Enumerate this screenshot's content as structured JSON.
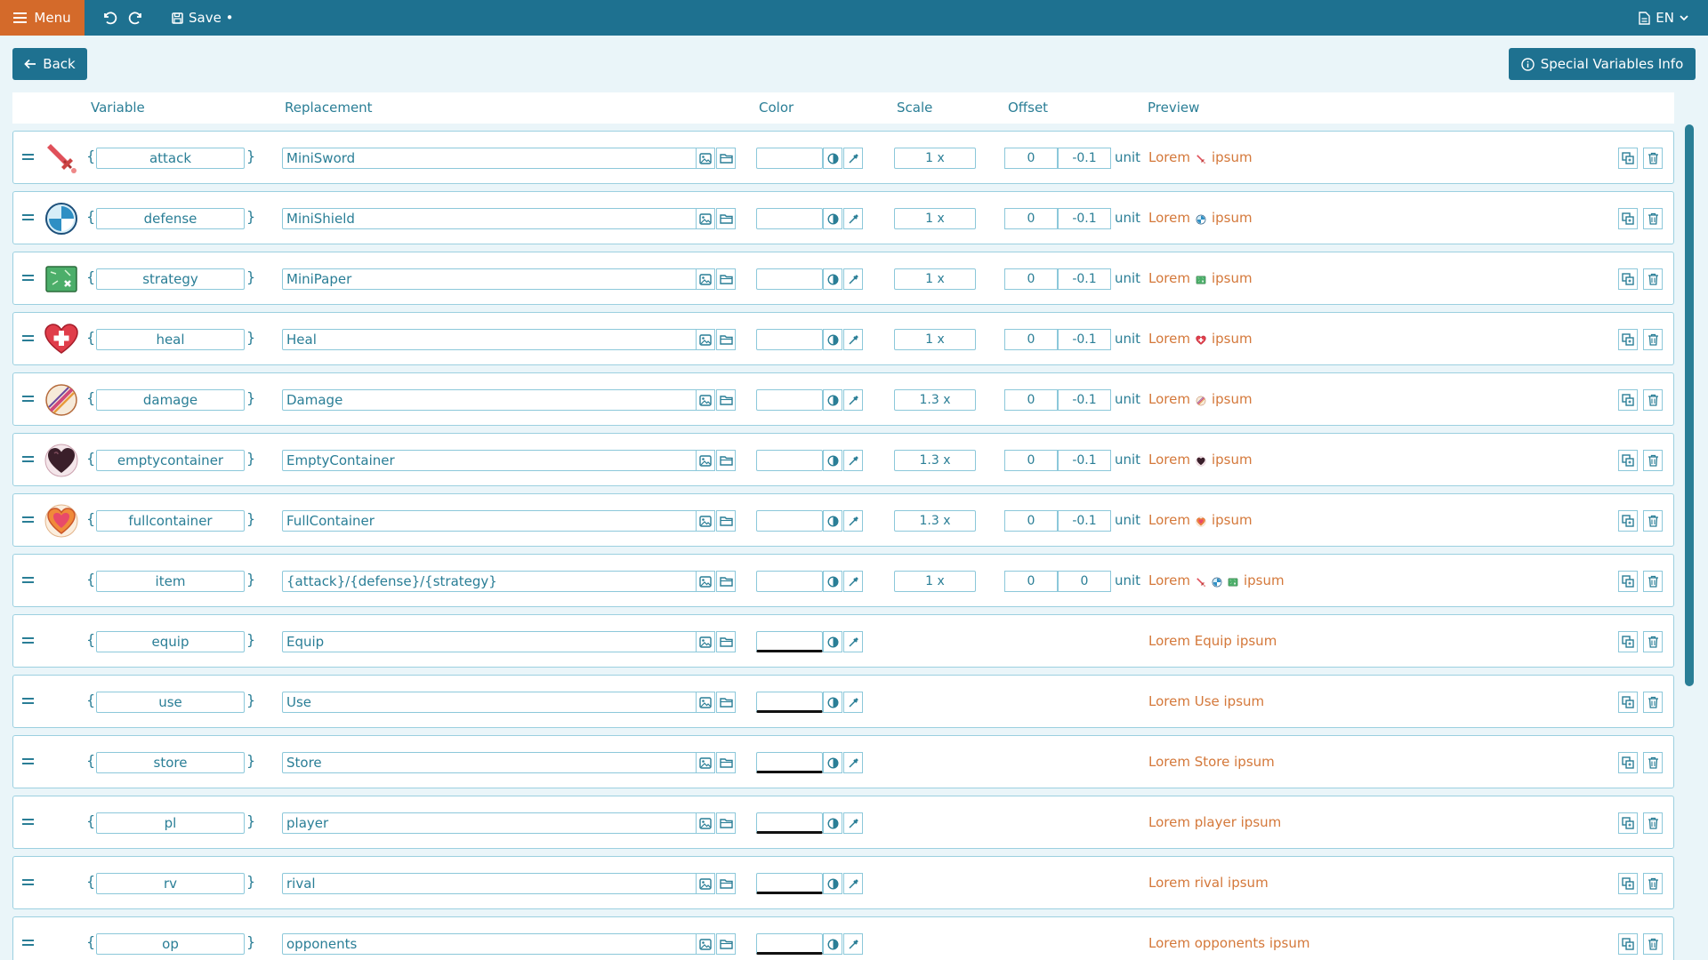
{
  "topbar": {
    "menu_label": "Menu",
    "save_label": "Save •",
    "lang_label": "EN"
  },
  "actions": {
    "back_label": "Back",
    "info_label": "Special Variables Info"
  },
  "columns": {
    "variable": "Variable",
    "replacement": "Replacement",
    "color": "Color",
    "scale": "Scale",
    "offset": "Offset",
    "preview": "Preview"
  },
  "unit_label": "unit",
  "rows": [
    {
      "variable": "attack",
      "replacement": "MiniSword",
      "scale": "1 x",
      "offset_x": "0",
      "offset_y": "-0.1",
      "icon": "sword-icon",
      "icon_color": "#e0505a",
      "preview_before": "Lorem",
      "preview_after": "ipsum",
      "preview_icons": [
        "sword-icon"
      ]
    },
    {
      "variable": "defense",
      "replacement": "MiniShield",
      "scale": "1 x",
      "offset_x": "0",
      "offset_y": "-0.1",
      "icon": "shield-icon",
      "icon_color": "#2f8fc4",
      "preview_before": "Lorem",
      "preview_after": "ipsum",
      "preview_icons": [
        "shield-icon"
      ]
    },
    {
      "variable": "strategy",
      "replacement": "MiniPaper",
      "scale": "1 x",
      "offset_x": "0",
      "offset_y": "-0.1",
      "icon": "map-icon",
      "icon_color": "#4cae6a",
      "preview_before": "Lorem",
      "preview_after": "ipsum",
      "preview_icons": [
        "map-icon"
      ]
    },
    {
      "variable": "heal",
      "replacement": "Heal",
      "scale": "1 x",
      "offset_x": "0",
      "offset_y": "-0.1",
      "icon": "heal-heart-icon",
      "icon_color": "#e03d4a",
      "preview_before": "Lorem",
      "preview_after": "ipsum",
      "preview_icons": [
        "heal-heart-icon"
      ]
    },
    {
      "variable": "damage",
      "replacement": "Damage",
      "scale": "1.3 x",
      "offset_x": "0",
      "offset_y": "-0.1",
      "icon": "damage-slash-icon",
      "icon_color": "#d04a7a",
      "preview_before": "Lorem",
      "preview_after": "ipsum",
      "preview_icons": [
        "damage-slash-icon"
      ]
    },
    {
      "variable": "emptycontainer",
      "replacement": "EmptyContainer",
      "scale": "1.3 x",
      "offset_x": "0",
      "offset_y": "-0.1",
      "icon": "empty-heart-icon",
      "icon_color": "#3a1f2a",
      "preview_before": "Lorem",
      "preview_after": "ipsum",
      "preview_icons": [
        "empty-heart-icon"
      ]
    },
    {
      "variable": "fullcontainer",
      "replacement": "FullContainer",
      "scale": "1.3 x",
      "offset_x": "0",
      "offset_y": "-0.1",
      "icon": "full-heart-icon",
      "icon_color": "#f08a3a",
      "preview_before": "Lorem",
      "preview_after": "ipsum",
      "preview_icons": [
        "full-heart-icon"
      ]
    },
    {
      "variable": "item",
      "replacement": "{attack}/{defense}/{strategy}",
      "scale": "1 x",
      "offset_x": "0",
      "offset_y": "0",
      "icon": "",
      "icon_color": "",
      "preview_before": "Lorem",
      "preview_after": "ipsum",
      "preview_icons": [
        "sword-icon",
        "shield-icon",
        "map-icon"
      ]
    },
    {
      "variable": "equip",
      "replacement": "Equip",
      "scale": "",
      "offset_x": "",
      "offset_y": "",
      "icon": "",
      "icon_color": "",
      "preview_before": "Lorem Equip ipsum",
      "preview_after": "",
      "preview_icons": []
    },
    {
      "variable": "use",
      "replacement": "Use",
      "scale": "",
      "offset_x": "",
      "offset_y": "",
      "icon": "",
      "icon_color": "",
      "preview_before": "Lorem Use ipsum",
      "preview_after": "",
      "preview_icons": []
    },
    {
      "variable": "store",
      "replacement": "Store",
      "scale": "",
      "offset_x": "",
      "offset_y": "",
      "icon": "",
      "icon_color": "",
      "preview_before": "Lorem Store ipsum",
      "preview_after": "",
      "preview_icons": []
    },
    {
      "variable": "pl",
      "replacement": "player",
      "scale": "",
      "offset_x": "",
      "offset_y": "",
      "icon": "",
      "icon_color": "",
      "preview_before": "Lorem player ipsum",
      "preview_after": "",
      "preview_icons": []
    },
    {
      "variable": "rv",
      "replacement": "rival",
      "scale": "",
      "offset_x": "",
      "offset_y": "",
      "icon": "",
      "icon_color": "",
      "preview_before": "Lorem rival ipsum",
      "preview_after": "",
      "preview_icons": []
    },
    {
      "variable": "op",
      "replacement": "opponents",
      "scale": "",
      "offset_x": "",
      "offset_y": "",
      "icon": "",
      "icon_color": "",
      "preview_before": "Lorem opponents ipsum",
      "preview_after": "",
      "preview_icons": []
    }
  ],
  "colors": {
    "topbar": "#1e7190",
    "menu": "#d46a2a",
    "text": "#2a7e96",
    "preview": "#d4783a"
  }
}
